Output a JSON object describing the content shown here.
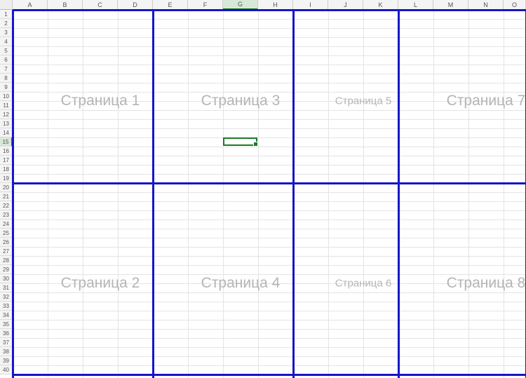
{
  "columns": [
    {
      "label": "A",
      "width": 50
    },
    {
      "label": "B",
      "width": 50
    },
    {
      "label": "C",
      "width": 50
    },
    {
      "label": "D",
      "width": 50
    },
    {
      "label": "E",
      "width": 50
    },
    {
      "label": "F",
      "width": 50
    },
    {
      "label": "G",
      "width": 50,
      "active": true
    },
    {
      "label": "H",
      "width": 50
    },
    {
      "label": "I",
      "width": 50
    },
    {
      "label": "J",
      "width": 50
    },
    {
      "label": "K",
      "width": 50
    },
    {
      "label": "L",
      "width": 50
    },
    {
      "label": "M",
      "width": 50
    },
    {
      "label": "N",
      "width": 50
    },
    {
      "label": "O",
      "width": 32
    }
  ],
  "rows": [
    {
      "n": 1,
      "h": 13
    },
    {
      "n": 2,
      "h": 13
    },
    {
      "n": 3,
      "h": 13
    },
    {
      "n": 4,
      "h": 13
    },
    {
      "n": 5,
      "h": 13
    },
    {
      "n": 6,
      "h": 13
    },
    {
      "n": 7,
      "h": 13
    },
    {
      "n": 8,
      "h": 13
    },
    {
      "n": 9,
      "h": 13
    },
    {
      "n": 10,
      "h": 13
    },
    {
      "n": 11,
      "h": 13
    },
    {
      "n": 12,
      "h": 13
    },
    {
      "n": 13,
      "h": 13
    },
    {
      "n": 14,
      "h": 13
    },
    {
      "n": 15,
      "h": 13,
      "active": true
    },
    {
      "n": 16,
      "h": 13
    },
    {
      "n": 17,
      "h": 13
    },
    {
      "n": 18,
      "h": 13
    },
    {
      "n": 19,
      "h": 13
    },
    {
      "n": 20,
      "h": 13
    },
    {
      "n": 21,
      "h": 13
    },
    {
      "n": 22,
      "h": 13
    },
    {
      "n": 23,
      "h": 13
    },
    {
      "n": 24,
      "h": 13
    },
    {
      "n": 25,
      "h": 13
    },
    {
      "n": 26,
      "h": 13
    },
    {
      "n": 27,
      "h": 13
    },
    {
      "n": 28,
      "h": 13
    },
    {
      "n": 29,
      "h": 13
    },
    {
      "n": 30,
      "h": 13
    },
    {
      "n": 31,
      "h": 13
    },
    {
      "n": 32,
      "h": 13
    },
    {
      "n": 33,
      "h": 13
    },
    {
      "n": 34,
      "h": 13
    },
    {
      "n": 35,
      "h": 13
    },
    {
      "n": 36,
      "h": 13
    },
    {
      "n": 37,
      "h": 13
    },
    {
      "n": 38,
      "h": 13
    },
    {
      "n": 39,
      "h": 13
    },
    {
      "n": 40,
      "h": 13
    }
  ],
  "page_breaks": {
    "vertical_after_cols": [
      0,
      4,
      8,
      11,
      15
    ],
    "horizontal_after_rows": [
      0,
      19,
      40
    ]
  },
  "page_watermarks": [
    {
      "text": "Страница 1",
      "col_center": 2.5,
      "row_center": 10,
      "size": "large"
    },
    {
      "text": "Страница 3",
      "col_center": 6.5,
      "row_center": 10,
      "size": "large"
    },
    {
      "text": "Страница 5",
      "col_center": 10,
      "row_center": 10,
      "size": "small"
    },
    {
      "text": "Страница 7",
      "col_center": 13.5,
      "row_center": 10,
      "size": "large"
    },
    {
      "text": "Страница 2",
      "col_center": 2.5,
      "row_center": 30,
      "size": "large"
    },
    {
      "text": "Страница 4",
      "col_center": 6.5,
      "row_center": 30,
      "size": "large"
    },
    {
      "text": "Страница 6",
      "col_center": 10,
      "row_center": 30,
      "size": "small"
    },
    {
      "text": "Страница 8",
      "col_center": 13.5,
      "row_center": 30,
      "size": "large"
    }
  ],
  "selected_cell": {
    "col": "G",
    "row": 15
  },
  "colors": {
    "page_break": "#1616c7",
    "selection": "#1a7a2a",
    "watermark": "#b5b5b5"
  }
}
